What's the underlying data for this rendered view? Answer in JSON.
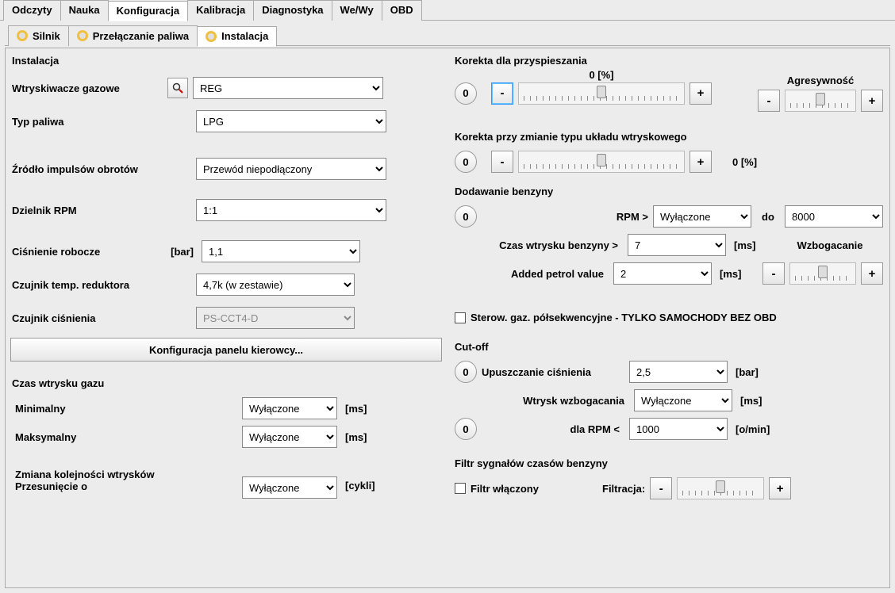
{
  "tabs_main": [
    "Odczyty",
    "Nauka",
    "Konfiguracja",
    "Kalibracja",
    "Diagnostyka",
    "We/Wy",
    "OBD"
  ],
  "tabs_sub": [
    "Silnik",
    "Przełączanie paliwa",
    "Instalacja"
  ],
  "left": {
    "title": "Instalacja",
    "injectors_label": "Wtryskiwacze gazowe",
    "injectors_value": "REG",
    "fuel_label": "Typ paliwa",
    "fuel_value": "LPG",
    "rpm_src_label": "Źródło impulsów obrotów",
    "rpm_src_value": "Przewód niepodłączony",
    "rpm_div_label": "Dzielnik RPM",
    "rpm_div_value": "1:1",
    "pressure_label": "Ciśnienie robocze",
    "pressure_unit": "[bar]",
    "pressure_value": "1,1",
    "temp_label": "Czujnik temp. reduktora",
    "temp_value": "4,7k (w zestawie)",
    "psens_label": "Czujnik ciśnienia",
    "psens_value": "PS-CCT4-D",
    "panel_btn": "Konfiguracja panelu kierowcy...",
    "gas_title": "Czas wtrysku gazu",
    "gas_min_label": "Minimalny",
    "gas_min_value": "Wyłączone",
    "gas_max_label": "Maksymalny",
    "gas_max_value": "Wyłączone",
    "ms_unit": "[ms]",
    "seq_label1": "Zmiana kolejności wtrysków",
    "seq_label2": "Przesunięcie o",
    "seq_value": "Wyłączone",
    "seq_unit": "[cykli]"
  },
  "right": {
    "accel_title": "Korekta dla przyspieszania",
    "accel_value": "0  [%]",
    "aggr_title": "Agresywność",
    "injsys_title": "Korekta przy zmianie typu układu wtryskowego",
    "injsys_value": "0  [%]",
    "addfuel_title": "Dodawanie benzyny",
    "rpm_gt": "RPM >",
    "rpm_gt_value": "Wyłączone",
    "to": "do",
    "rpm_to_value": "8000",
    "petrol_time_label": "Czas wtrysku benzyny >",
    "petrol_time_value": "7",
    "added_petrol_label": "Added petrol value",
    "added_petrol_value": "2",
    "enrich_title": "Wzbogacanie",
    "ms_unit": "[ms]",
    "semiseq_label": "Sterow. gaz. półsekwencyjne - TYLKO SAMOCHODY BEZ OBD",
    "cutoff_title": "Cut-off",
    "cutoff_drop_label": "Upuszczanie ciśnienia",
    "cutoff_drop_value": "2,5",
    "bar_unit": "[bar]",
    "cutoff_enrich_label": "Wtrysk wzbogacania",
    "cutoff_enrich_value": "Wyłączone",
    "cutoff_rpm_label": "dla RPM <",
    "cutoff_rpm_value": "1000",
    "omin_unit": "[o/min]",
    "filter_title": "Filtr sygnałów czasów benzyny",
    "filter_on_label": "Filtr włączony",
    "filter_label": "Filtracja:",
    "zero": "0",
    "minus": "-",
    "plus": "+"
  }
}
